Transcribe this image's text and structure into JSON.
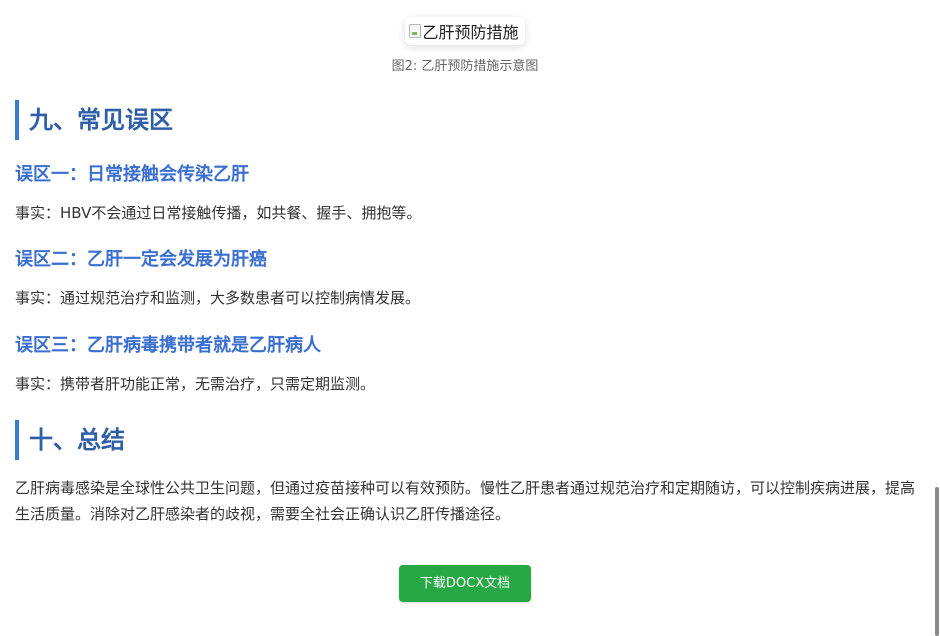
{
  "figure": {
    "image_alt": "乙肝预防措施",
    "caption": "图2: 乙肝预防措施示意图"
  },
  "section9": {
    "title": "九、常见误区",
    "myths": [
      {
        "title": "误区一：日常接触会传染乙肝",
        "fact": "事实：HBV不会通过日常接触传播，如共餐、握手、拥抱等。"
      },
      {
        "title": "误区二：乙肝一定会发展为肝癌",
        "fact": "事实：通过规范治疗和监测，大多数患者可以控制病情发展。"
      },
      {
        "title": "误区三：乙肝病毒携带者就是乙肝病人",
        "fact": "事实：携带者肝功能正常，无需治疗，只需定期监测。"
      }
    ]
  },
  "section10": {
    "title": "十、总结",
    "paragraph": "乙肝病毒感染是全球性公共卫生问题，但通过疫苗接种可以有效预防。慢性乙肝患者通过规范治疗和定期随访，可以控制疾病进展，提高生活质量。消除对乙肝感染者的歧视，需要全社会正确认识乙肝传播途径。"
  },
  "download_button": {
    "label": "下载DOCX文档"
  },
  "colors": {
    "heading": "#2f5fa7",
    "subheading": "#3a6fd0",
    "accent_bar": "#3a7bd5",
    "button": "#28a745"
  }
}
